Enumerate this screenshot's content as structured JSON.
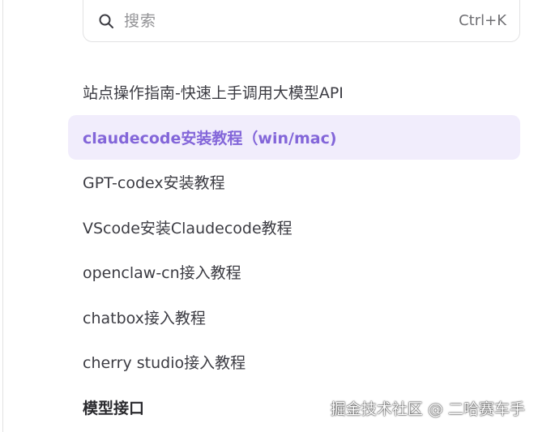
{
  "search": {
    "placeholder": "搜索",
    "shortcut": "Ctrl+K",
    "icon": "search-icon"
  },
  "nav": {
    "items": [
      {
        "label": "站点操作指南-快速上手调用大模型API",
        "active": false
      },
      {
        "label": "claudecode安装教程（win/mac)",
        "active": true
      },
      {
        "label": "GPT-codex安装教程",
        "active": false
      },
      {
        "label": "VScode安装Claudecode教程",
        "active": false
      },
      {
        "label": "openclaw-cn接入教程",
        "active": false
      },
      {
        "label": "chatbox接入教程",
        "active": false
      },
      {
        "label": "cherry studio接入教程",
        "active": false
      }
    ],
    "section_title": "模型接口"
  },
  "watermark": "掘金技术社区 @ 二哈赛车手",
  "colors": {
    "accent": "#8366d9",
    "active_background": "#f1edfc",
    "text": "#3c3c43",
    "border": "#e2e2e3"
  }
}
